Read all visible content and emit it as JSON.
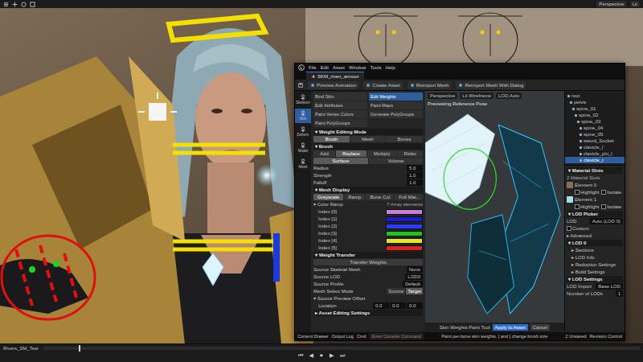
{
  "topbar": {
    "right": [
      "Perspective",
      "Lit"
    ]
  },
  "editor": {
    "menu": [
      "File",
      "Edit",
      "Asset",
      "Window",
      "Tools",
      "Help"
    ],
    "tab": "SKM_riven_armour",
    "toolbar": [
      "Preview Animation",
      "Create Asset",
      "Reimport Mesh",
      "Reimport Mesh With Dialog"
    ],
    "modes": [
      {
        "label": "Skeleton",
        "selected": false
      },
      {
        "label": "Skin",
        "selected": true
      },
      {
        "label": "Deform",
        "selected": false
      },
      {
        "label": "Model",
        "selected": false
      },
      {
        "label": "Mesh",
        "selected": false
      }
    ],
    "tools": [
      {
        "label": "Bind Skin",
        "selected": false
      },
      {
        "label": "Edit Weights",
        "selected": true
      },
      {
        "label": "Edit Attributes",
        "selected": false
      },
      {
        "label": "Paint Maps",
        "selected": false
      },
      {
        "label": "Paint Vertex Colors",
        "selected": false
      },
      {
        "label": "Generate PolyGroups",
        "selected": false
      },
      {
        "label": "Paint PolyGroups",
        "selected": false
      }
    ],
    "weight_mode": {
      "title": "Weight Editing Mode",
      "options": [
        {
          "label": "Brush",
          "selected": true
        },
        {
          "label": "Mesh",
          "selected": false
        },
        {
          "label": "Bones",
          "selected": false
        }
      ]
    },
    "brush": {
      "title": "Brush",
      "ops": [
        {
          "label": "Add",
          "selected": false
        },
        {
          "label": "Replace",
          "selected": true
        },
        {
          "label": "Multiply",
          "selected": false
        },
        {
          "label": "Relax",
          "selected": false
        }
      ],
      "falloff": [
        {
          "label": "Surface",
          "selected": true
        },
        {
          "label": "Volume",
          "selected": false
        }
      ],
      "fields": [
        {
          "label": "Radius",
          "value": "5.0"
        },
        {
          "label": "Strength",
          "value": "1.0"
        },
        {
          "label": "Falloff",
          "value": "1.0"
        }
      ]
    },
    "mesh_display": {
      "title": "Mesh Display",
      "options": [
        {
          "label": "Greyscale",
          "selected": true
        },
        {
          "label": "Ramp",
          "selected": false
        },
        {
          "label": "Bone Col",
          "selected": false
        },
        {
          "label": "Full Mat..",
          "selected": false
        }
      ]
    },
    "color_ramp": {
      "label": "Color Ramp",
      "count": "7 Array elements",
      "items": [
        {
          "label": "Index [0]",
          "color": "#c77dd6"
        },
        {
          "label": "Index [1]",
          "color": "#1a1acc"
        },
        {
          "label": "Index [2]",
          "color": "#2a3cff"
        },
        {
          "label": "Index [3]",
          "color": "#22c022"
        },
        {
          "label": "Index [4]",
          "color": "#e8e820"
        },
        {
          "label": "Index [5]",
          "color": "#e02020"
        }
      ]
    },
    "weight_transfer": {
      "title": "Weight Transfer",
      "button": "Transfer Weights",
      "fields": [
        {
          "label": "Source Skeletal Mesh",
          "value": "None"
        },
        {
          "label": "Source LOD",
          "value": "LOD0"
        },
        {
          "label": "Source Profile",
          "value": "Default"
        }
      ],
      "select_mode": {
        "label": "Mesh Select Mode",
        "options": [
          {
            "label": "Source",
            "selected": false
          },
          {
            "label": "Target",
            "selected": true
          }
        ]
      },
      "offset": "Source Preview Offset",
      "location": {
        "label": "Location",
        "values": [
          "0.0",
          "0.0",
          "0.0"
        ]
      }
    },
    "asset_settings": "Asset Editing Settings",
    "viewport": {
      "buttons": [
        "Perspective",
        "Lit Wireframe",
        "LOD Auto"
      ],
      "caption": "Previewing Reference Pose",
      "tool": "Skin Weights Paint Tool",
      "accept": "Apply to Asset",
      "cancel": "Cancel"
    },
    "tree": [
      {
        "label": "root",
        "depth": 0,
        "selected": false
      },
      {
        "label": "pelvis",
        "depth": 1,
        "selected": false
      },
      {
        "label": "spine_01",
        "depth": 2,
        "selected": false
      },
      {
        "label": "spine_02",
        "depth": 3,
        "selected": false
      },
      {
        "label": "spine_03",
        "depth": 4,
        "selected": false
      },
      {
        "label": "spine_04",
        "depth": 5,
        "selected": false
      },
      {
        "label": "spine_05",
        "depth": 5,
        "selected": false
      },
      {
        "label": "sword_Socket",
        "depth": 5,
        "selected": false
      },
      {
        "label": "clavicle_l",
        "depth": 5,
        "selected": false
      },
      {
        "label": "clavicle_pin_l",
        "depth": 5,
        "selected": false
      },
      {
        "label": "clavicle_r",
        "depth": 5,
        "selected": true
      }
    ],
    "details": {
      "material": {
        "title": "Material Slots",
        "value": "2 Material Slots",
        "slots": [
          {
            "label": "Element 0",
            "toggles": [
              "Highlight",
              "Isolate"
            ],
            "color": "#8a7050"
          },
          {
            "label": "Element 1",
            "toggles": [
              "Highlight",
              "Isolate"
            ],
            "color": "#a8dcec"
          }
        ]
      },
      "lod_picker": {
        "title": "LOD Picker",
        "label": "LOD",
        "value": "Auto (LOD 0)",
        "custom": "Custom"
      },
      "advanced": "Advanced",
      "lod0": {
        "title": "LOD 0",
        "items": [
          "Sections",
          "LOD Info",
          "Reduction Settings",
          "Build Settings"
        ]
      },
      "lod_settings": {
        "title": "LOD Settings",
        "rows": [
          {
            "label": "LOD Import",
            "value": "Base LOD"
          },
          {
            "label": "Number of LODs",
            "value": "1"
          }
        ]
      }
    },
    "status": {
      "items": [
        "Content Drawer",
        "Output Log",
        "Cmd"
      ],
      "placeholder": "Enter Console Command",
      "hint": "Paint per-bone skin weights. [ and ] change brush size",
      "unsaved": "2 Unsaved",
      "revision": "Revision Control"
    }
  },
  "timeline": {
    "label": "Rivers_SM_Test",
    "controls": [
      "⏮",
      "◀",
      "⏺",
      "▶",
      "⏭"
    ]
  }
}
